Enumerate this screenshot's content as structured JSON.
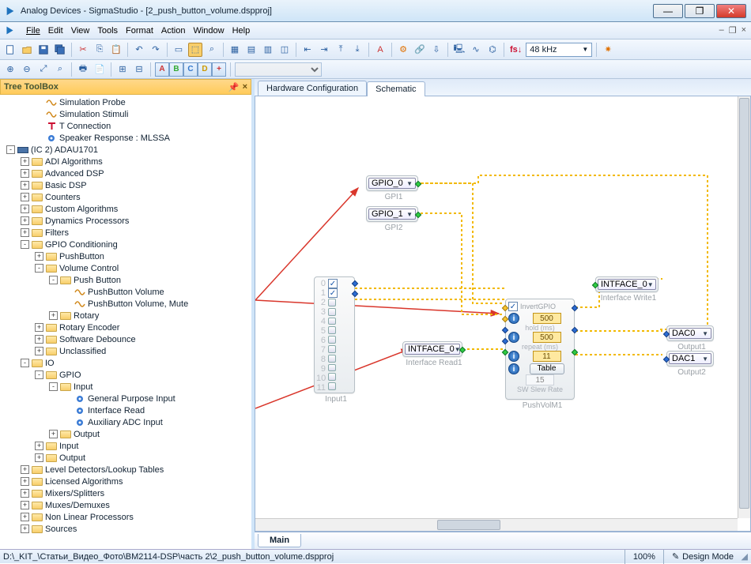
{
  "title": "Analog Devices - SigmaStudio - [2_push_button_volume.dspproj]",
  "menu": [
    "File",
    "Edit",
    "View",
    "Tools",
    "Format",
    "Action",
    "Window",
    "Help"
  ],
  "sample_rate": "48 kHz",
  "treetoolbox": {
    "title": "Tree ToolBox"
  },
  "tabs": {
    "hwconfig": "Hardware Configuration",
    "schematic": "Schematic",
    "main": "Main"
  },
  "tree": [
    {
      "d": 2,
      "e": "",
      "i": "wave",
      "t": "Simulation Probe"
    },
    {
      "d": 2,
      "e": "",
      "i": "wave",
      "t": "Simulation Stimuli"
    },
    {
      "d": 2,
      "e": "",
      "i": "tconn",
      "t": "T Connection"
    },
    {
      "d": 2,
      "e": "",
      "i": "dot",
      "t": "Speaker Response : MLSSA"
    },
    {
      "d": 0,
      "e": "-",
      "i": "chip",
      "t": "(IC 2) ADAU1701"
    },
    {
      "d": 1,
      "e": "+",
      "i": "folder",
      "t": "ADI Algorithms"
    },
    {
      "d": 1,
      "e": "+",
      "i": "folder",
      "t": "Advanced DSP"
    },
    {
      "d": 1,
      "e": "+",
      "i": "folder",
      "t": "Basic DSP"
    },
    {
      "d": 1,
      "e": "+",
      "i": "folder",
      "t": "Counters"
    },
    {
      "d": 1,
      "e": "+",
      "i": "folder",
      "t": "Custom Algorithms"
    },
    {
      "d": 1,
      "e": "+",
      "i": "folder",
      "t": "Dynamics Processors"
    },
    {
      "d": 1,
      "e": "+",
      "i": "folder",
      "t": "Filters"
    },
    {
      "d": 1,
      "e": "-",
      "i": "folder",
      "t": "GPIO Conditioning"
    },
    {
      "d": 2,
      "e": "+",
      "i": "folder",
      "t": "PushButton"
    },
    {
      "d": 2,
      "e": "-",
      "i": "folder",
      "t": "Volume Control"
    },
    {
      "d": 3,
      "e": "-",
      "i": "folder",
      "t": "Push Button"
    },
    {
      "d": 4,
      "e": "",
      "i": "wave",
      "t": "PushButton Volume"
    },
    {
      "d": 4,
      "e": "",
      "i": "wave",
      "t": "PushButton Volume, Mute"
    },
    {
      "d": 3,
      "e": "+",
      "i": "folder",
      "t": "Rotary"
    },
    {
      "d": 2,
      "e": "+",
      "i": "folder",
      "t": "Rotary Encoder"
    },
    {
      "d": 2,
      "e": "+",
      "i": "folder",
      "t": "Software Debounce"
    },
    {
      "d": 2,
      "e": "+",
      "i": "folder",
      "t": "Unclassified"
    },
    {
      "d": 1,
      "e": "-",
      "i": "folder",
      "t": "IO"
    },
    {
      "d": 2,
      "e": "-",
      "i": "folder",
      "t": "GPIO"
    },
    {
      "d": 3,
      "e": "-",
      "i": "folder",
      "t": "Input"
    },
    {
      "d": 4,
      "e": "",
      "i": "dot",
      "t": "General Purpose Input"
    },
    {
      "d": 4,
      "e": "",
      "i": "dot",
      "t": "Interface Read"
    },
    {
      "d": 4,
      "e": "",
      "i": "dot",
      "t": "Auxiliary ADC Input"
    },
    {
      "d": 3,
      "e": "+",
      "i": "folder",
      "t": "Output"
    },
    {
      "d": 2,
      "e": "+",
      "i": "folder",
      "t": "Input"
    },
    {
      "d": 2,
      "e": "+",
      "i": "folder",
      "t": "Output"
    },
    {
      "d": 1,
      "e": "+",
      "i": "folder",
      "t": "Level Detectors/Lookup Tables"
    },
    {
      "d": 1,
      "e": "+",
      "i": "folder",
      "t": "Licensed Algorithms"
    },
    {
      "d": 1,
      "e": "+",
      "i": "folder",
      "t": "Mixers/Splitters"
    },
    {
      "d": 1,
      "e": "+",
      "i": "folder",
      "t": "Muxes/Demuxes"
    },
    {
      "d": 1,
      "e": "+",
      "i": "folder",
      "t": "Non Linear Processors"
    },
    {
      "d": 1,
      "e": "+",
      "i": "folder",
      "t": "Sources"
    }
  ],
  "blocks": {
    "gpi1": {
      "dd": "GPIO_0",
      "cap": "GPI1"
    },
    "gpi2": {
      "dd": "GPIO_1",
      "cap": "GPI2"
    },
    "input1": {
      "cap": "Input1",
      "nums": [
        "0",
        "1",
        "2",
        "3",
        "4",
        "5",
        "6",
        "7",
        "8",
        "9",
        "10",
        "11"
      ]
    },
    "ifread": {
      "dd": "INTFACE_0",
      "cap": "Interface Read1"
    },
    "pushvol": {
      "chk_label": "InvertGPIO",
      "hold": "500",
      "hold_lbl": "hold (ms)",
      "repeat": "500",
      "repeat_lbl": "repeat (ms)",
      "steps": "11",
      "steps_lbl": "",
      "tbl": "Table",
      "slew": "15",
      "slew_lbl": "SW Slew Rate",
      "cap": "PushVolM1"
    },
    "ifwrite": {
      "dd": "INTFACE_0",
      "cap": "Interface Write1"
    },
    "out1": {
      "dd": "DAC0",
      "cap": "Output1"
    },
    "out2": {
      "dd": "DAC1",
      "cap": "Output2"
    }
  },
  "status": {
    "path": "D:\\_KIT_\\Статьи_Видео_Фото\\BM2114-DSP\\часть 2\\2_push_button_volume.dspproj",
    "zoom": "100%",
    "mode": "Design Mode"
  }
}
